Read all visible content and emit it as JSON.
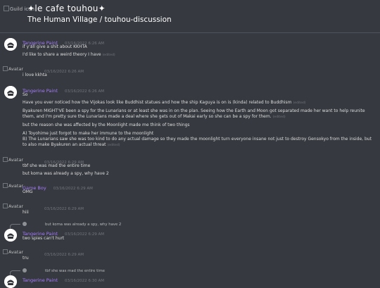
{
  "header": {
    "guild_icon_alt": "Guild icon",
    "guild_name": "✦le cafe touhou✦",
    "channel_path": "The Human Village / touhou-discussion"
  },
  "messages": [
    {
      "author": "Tangerine Paint",
      "timestamp": "03/16/2022 6:26 AM",
      "avatar": "default-avatar",
      "lines": [
        {
          "text": "if y'all give a shit about KKHTA",
          "edited": ""
        },
        {
          "text": "I'd like to share a weird theory I have",
          "edited": "(edited)"
        }
      ]
    },
    {
      "author": "",
      "avatar_alt": "Avatar",
      "timestamp": "03/16/2022 6:26 AM",
      "lines": [
        {
          "text": "i love kkhta",
          "edited": ""
        }
      ]
    },
    {
      "author": "Tangerine Paint",
      "timestamp": "03/16/2022 6:26 AM",
      "avatar": "default-avatar",
      "lines": [
        {
          "text": "So",
          "edited": ""
        },
        {
          "text": "Have you ever noticed how the Vijokas look like Buddhist statues and how the ship Kaguya is on is (kinda) related to Buddhism",
          "edited": "(edited)"
        },
        {
          "text": "Byakuren MIGHT'VE been a spy for the Lunarians or at least she was in on the plan. Seeing how the Earth and Moon got separated made her want to help reunite them, and I'm pretty sure the Lunarians made a deal where she gets out of Makai early so she can be a spy for them.",
          "edited": "(edited)"
        },
        {
          "text": "but the reason she was affected by the Moonlight made me think of two things",
          "edited": ""
        },
        {
          "text": "A) Toyohime just forgot to make her immune to the moonlight",
          "edited": ""
        },
        {
          "text": "B) The Lunarians saw she was too kind to do any actual damage so they made the moonlight turn everyone insane not just to destroy Gensokyo from the inside, but to also make Byakuren an actual threat",
          "edited": "(edited)"
        }
      ]
    },
    {
      "author": "",
      "avatar_alt": "Avatar",
      "timestamp": "03/16/2022 6:29 AM",
      "lines": [
        {
          "text": "tbf she was mad the entire time",
          "edited": ""
        },
        {
          "text": "but koma was already a spy, why have 2",
          "edited": ""
        }
      ]
    },
    {
      "author": "Game Boy",
      "avatar_alt": "Avatar",
      "timestamp": "03/16/2022 6:29 AM",
      "lines": [
        {
          "text": "OMG",
          "edited": ""
        }
      ]
    },
    {
      "author": "",
      "avatar_alt": "Avatar",
      "timestamp": "03/16/2022 6:29 AM",
      "lines": [
        {
          "text": "hiii",
          "edited": ""
        }
      ]
    },
    {
      "reply": {
        "author": "",
        "text": "but koma was already a spy, why have 2"
      },
      "author": "Tangerine Paint",
      "timestamp": "03/16/2022 6:29 AM",
      "avatar": "default-avatar",
      "lines": [
        {
          "text": "two spies can't hurt",
          "edited": ""
        }
      ]
    },
    {
      "author": "",
      "avatar_alt": "Avatar",
      "timestamp": "03/16/2022 6:29 AM",
      "lines": [
        {
          "text": "tru",
          "edited": ""
        }
      ]
    },
    {
      "reply": {
        "author": "",
        "text": "tbf she was mad the entire time"
      },
      "author": "Tangerine Paint",
      "timestamp": "03/16/2022 6:30 AM",
      "avatar": "default-avatar",
      "lines": []
    }
  ]
}
